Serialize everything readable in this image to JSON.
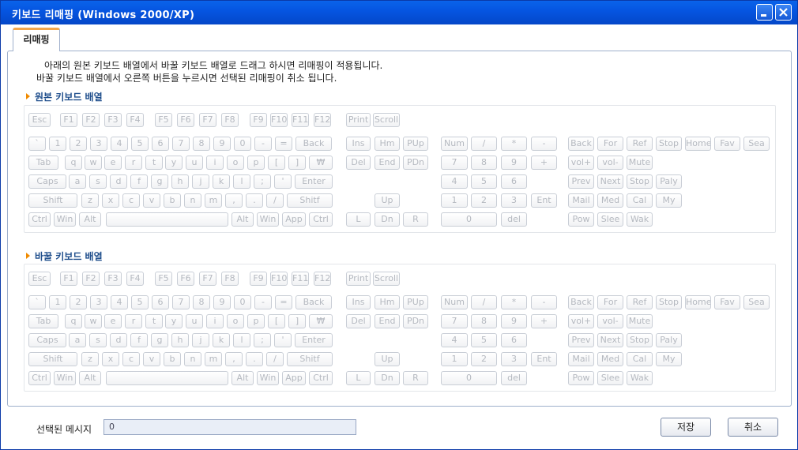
{
  "window": {
    "title": "키보드 리매핑 (Windows 2000/XP)"
  },
  "tab": {
    "label": "리매핑"
  },
  "instructions": [
    "아래의 원본 키보드 배열에서 바꿀 키보드 배열로 드래그 하시면 리매핑이 적용됩니다.",
    "바꿀 키보드 배열에서 오른쪽 버튼을 누르시면 선택된 리매핑이 취소 됩니다."
  ],
  "sections": [
    {
      "title": "원본 키보드 배열"
    },
    {
      "title": "바꿀 키보드 배열"
    }
  ],
  "keyboard": {
    "function_row": [
      "Esc",
      "F1",
      "F2",
      "F3",
      "F4",
      "F5",
      "F6",
      "F7",
      "F8",
      "F9",
      "F10",
      "F11",
      "F12",
      "Print",
      "Scroll"
    ],
    "main_rows": [
      [
        "`",
        "1",
        "2",
        "3",
        "4",
        "5",
        "6",
        "7",
        "8",
        "9",
        "0",
        "-",
        "=",
        "Back"
      ],
      [
        "Tab",
        "q",
        "w",
        "e",
        "r",
        "t",
        "y",
        "u",
        "i",
        "o",
        "p",
        "[",
        "]",
        "₩"
      ],
      [
        "Caps",
        "a",
        "s",
        "d",
        "f",
        "g",
        "h",
        "j",
        "k",
        "l",
        ";",
        "'",
        "Enter"
      ],
      [
        "Shift",
        "z",
        "x",
        "c",
        "v",
        "b",
        "n",
        "m",
        ",",
        ".",
        "/",
        "Shitf"
      ],
      [
        "Ctrl",
        "Win",
        "Alt",
        "",
        "Alt",
        "Win",
        "App",
        "Ctrl"
      ]
    ],
    "nav_rows": [
      [
        "Ins",
        "Hm",
        "PUp"
      ],
      [
        "Del",
        "End",
        "PDn"
      ],
      [],
      [
        "Up"
      ],
      [
        "L",
        "Dn",
        "R"
      ]
    ],
    "numpad_rows": [
      [
        "Num",
        "/",
        "*",
        "-"
      ],
      [
        "7",
        "8",
        "9",
        "+"
      ],
      [
        "4",
        "5",
        "6"
      ],
      [
        "1",
        "2",
        "3",
        "Ent"
      ],
      [
        "0",
        "del"
      ]
    ],
    "media_rows": [
      [
        "Back",
        "For",
        "Ref",
        "Stop",
        "Home",
        "Fav",
        "Sea"
      ],
      [
        "vol+",
        "vol-",
        "Mute"
      ],
      [
        "Prev",
        "Next",
        "Stop",
        "Paly"
      ],
      [
        "Mail",
        "Med",
        "Cal",
        "My"
      ],
      [
        "Pow",
        "Slee",
        "Wak"
      ]
    ]
  },
  "footer": {
    "message_label": "선택된 메시지",
    "message_value": "0",
    "save_label": "저장",
    "cancel_label": "취소"
  }
}
